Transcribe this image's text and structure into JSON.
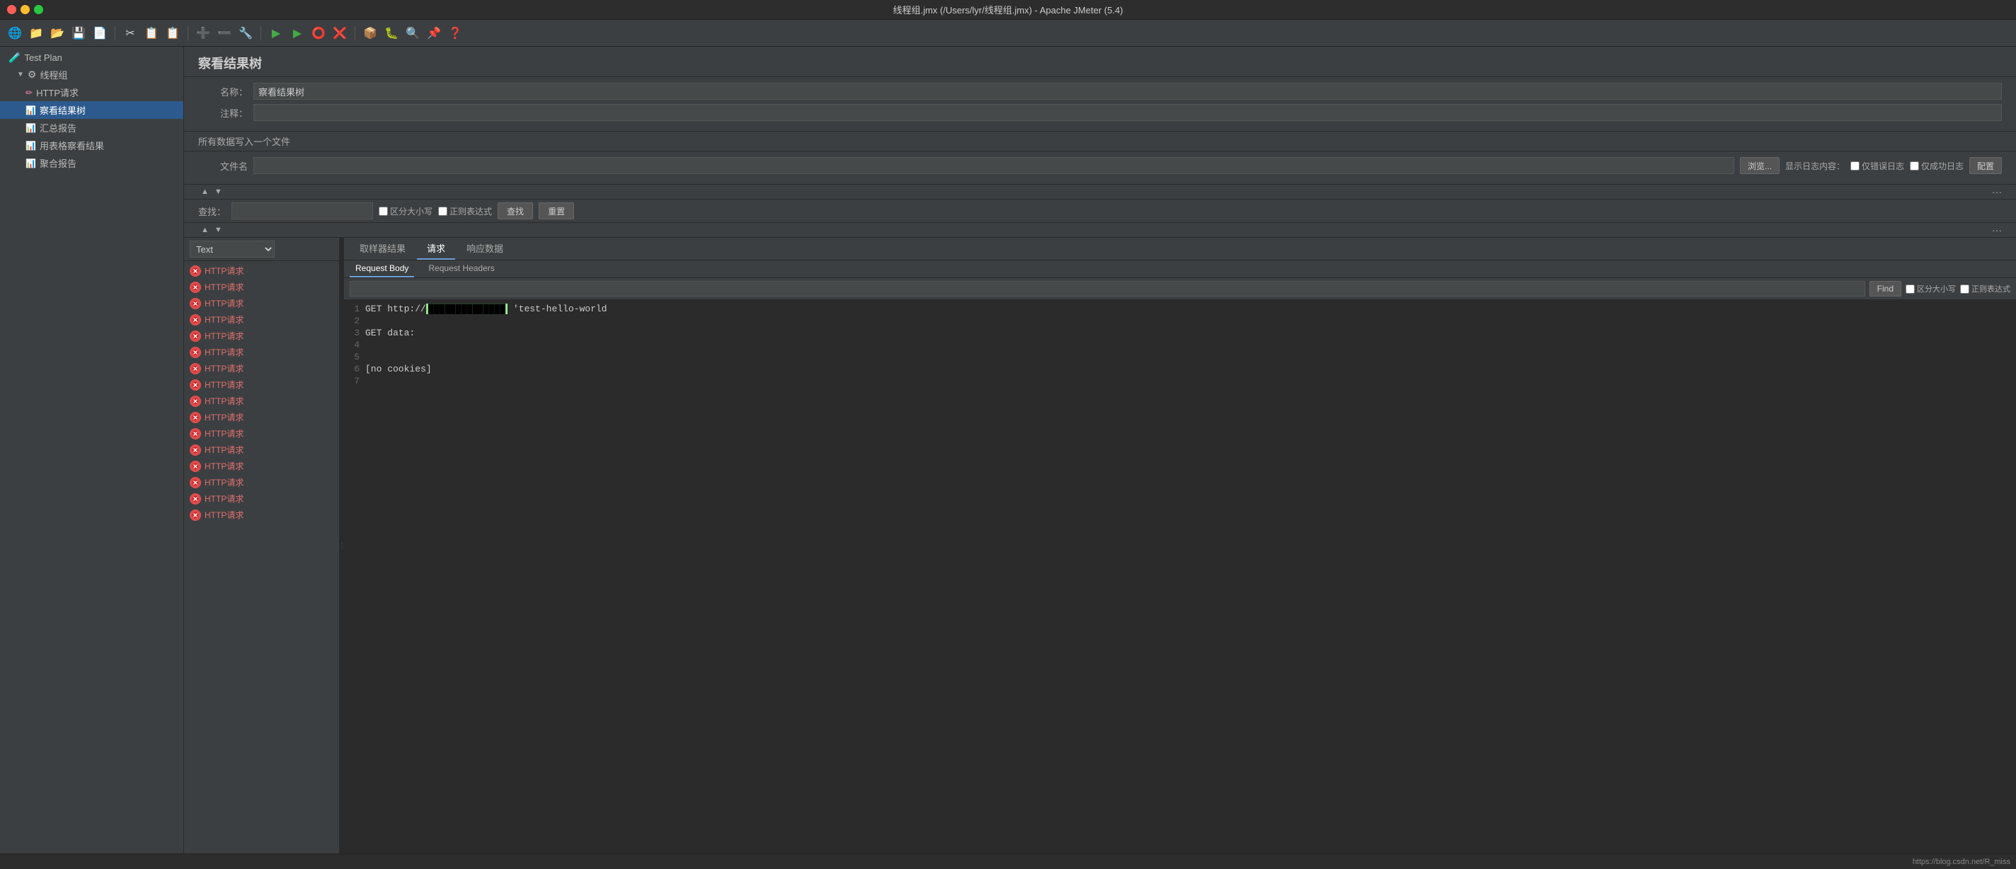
{
  "window": {
    "title": "线程组.jmx (/Users/lyr/线程组.jmx) - Apache JMeter (5.4)"
  },
  "toolbar": {
    "buttons": [
      "🌐",
      "💾",
      "📄",
      "✂",
      "📋",
      "📋",
      "➕",
      "➖",
      "🔧",
      "▶",
      "▶",
      "⭕",
      "❌",
      "📦",
      "🐞",
      "🔍",
      "📌",
      "❓"
    ]
  },
  "sidebar": {
    "items": [
      {
        "id": "test-plan",
        "label": "Test Plan",
        "icon": "🧪",
        "indent": 0
      },
      {
        "id": "thread-group",
        "label": "线程组",
        "icon": "⚙",
        "indent": 1
      },
      {
        "id": "http-request",
        "label": "HTTP请求",
        "icon": "✏",
        "indent": 2
      },
      {
        "id": "view-results-tree",
        "label": "察看结果树",
        "icon": "📊",
        "indent": 2,
        "active": true
      },
      {
        "id": "summary-report",
        "label": "汇总报告",
        "icon": "📊",
        "indent": 2
      },
      {
        "id": "view-results-table",
        "label": "用表格察看结果",
        "icon": "📊",
        "indent": 2
      },
      {
        "id": "aggregate-report",
        "label": "聚合报告",
        "icon": "📊",
        "indent": 2
      }
    ]
  },
  "panel": {
    "title": "察看结果树",
    "name_label": "名称：",
    "name_value": "察看结果树",
    "comment_label": "注释：",
    "comment_value": "",
    "all_data_text": "所有数据写入一个文件",
    "filename_label": "文件名",
    "filename_value": "",
    "browse_btn": "浏览...",
    "log_display_label": "显示日志内容：",
    "error_only_label": "仅错误日志",
    "success_only_label": "仅成功日志",
    "config_btn": "配置",
    "search_label": "查找：",
    "search_placeholder": "",
    "case_sensitive_label": "区分大小写",
    "regex_label": "正则表达式",
    "find_btn": "查找",
    "reset_btn": "重置"
  },
  "list_panel": {
    "dropdown_value": "Text",
    "requests": [
      "HTTP请求",
      "HTTP请求",
      "HTTP请求",
      "HTTP请求",
      "HTTP请求",
      "HTTP请求",
      "HTTP请求",
      "HTTP请求",
      "HTTP请求",
      "HTTP请求",
      "HTTP请求",
      "HTTP请求",
      "HTTP请求",
      "HTTP请求",
      "HTTP请求",
      "HTTP请求"
    ]
  },
  "tabs": {
    "items": [
      "取样器结果",
      "请求",
      "响应数据"
    ],
    "active": "请求"
  },
  "sub_tabs": {
    "items": [
      "Request Body",
      "Request Headers"
    ],
    "active": "Request Body"
  },
  "find_row": {
    "placeholder": "",
    "find_btn": "Find",
    "case_label": "区分大小写",
    "regex_label": "正则表达式"
  },
  "code": {
    "lines": [
      {
        "ln": "1",
        "text": "GET http://",
        "url_hidden": true,
        "suffix": " 'test-hello-world"
      },
      {
        "ln": "2",
        "text": ""
      },
      {
        "ln": "3",
        "text": "GET data:"
      },
      {
        "ln": "4",
        "text": ""
      },
      {
        "ln": "5",
        "text": ""
      },
      {
        "ln": "6",
        "text": "[no cookies]"
      },
      {
        "ln": "7",
        "text": ""
      }
    ]
  },
  "statusbar": {
    "url": "https://blog.csdn.net/R_miss"
  }
}
